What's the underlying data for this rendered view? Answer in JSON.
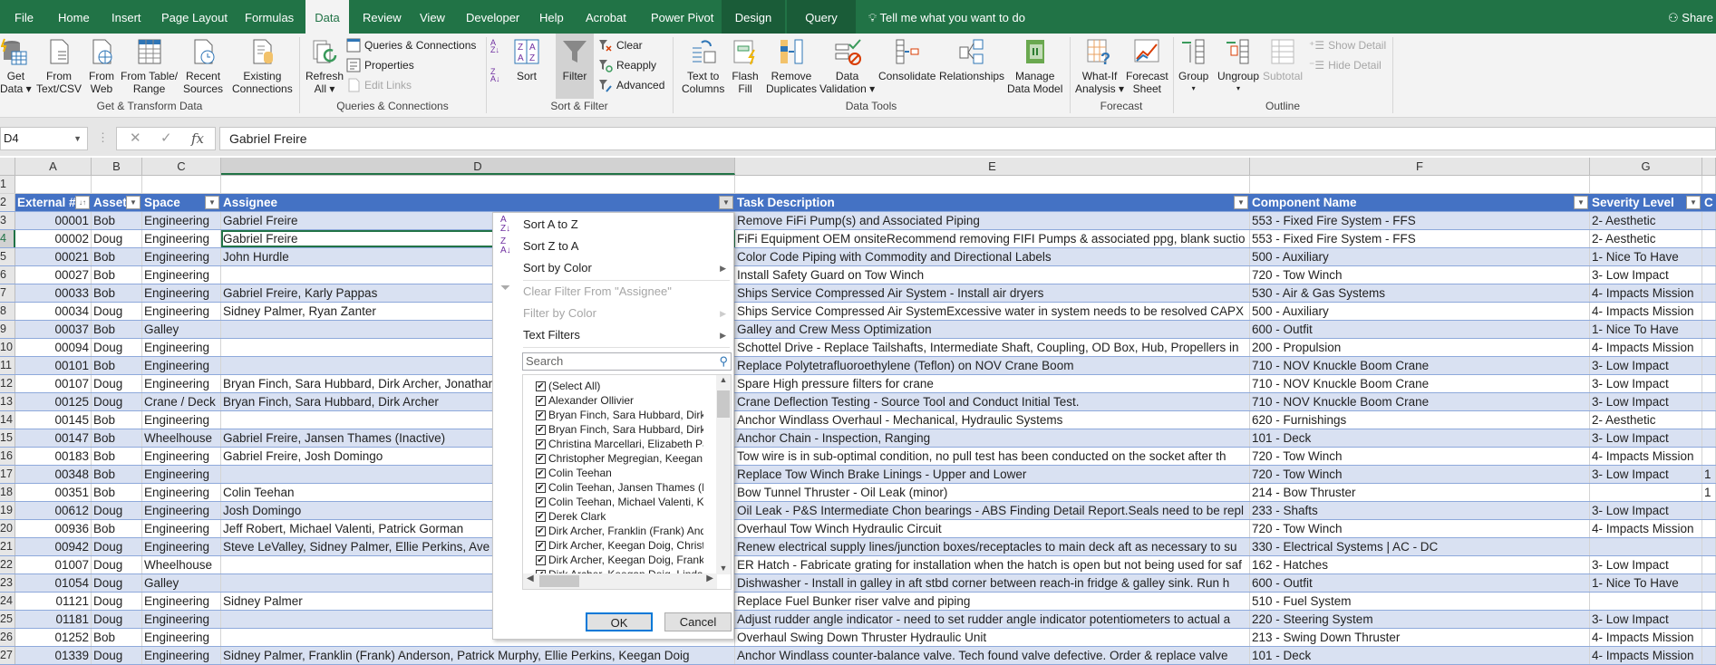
{
  "tabs": [
    "File",
    "Home",
    "Insert",
    "Page Layout",
    "Formulas",
    "Data",
    "Review",
    "View",
    "Developer",
    "Help",
    "Acrobat",
    "Power Pivot",
    "Design",
    "Query"
  ],
  "active_tab": "Data",
  "tell_me": "Tell me what you want to do",
  "share": "Share",
  "ribbon": {
    "get_data": [
      "Get",
      "Data ▾"
    ],
    "from_text": [
      "From",
      "Text/CSV"
    ],
    "from_web": [
      "From",
      "Web"
    ],
    "from_table": [
      "From Table/",
      "Range"
    ],
    "recent_sources": [
      "Recent",
      "Sources"
    ],
    "existing_connections": [
      "Existing",
      "Connections"
    ],
    "group_get_transform": "Get & Transform Data",
    "refresh_all": [
      "Refresh",
      "All ▾"
    ],
    "queries_connections": "Queries & Connections",
    "properties": "Properties",
    "edit_links": "Edit Links",
    "group_queries": "Queries & Connections",
    "sort": "Sort",
    "filter": "Filter",
    "clear": "Clear",
    "reapply": "Reapply",
    "advanced": "Advanced",
    "group_sort_filter": "Sort & Filter",
    "text_to_columns": [
      "Text to",
      "Columns"
    ],
    "flash_fill": [
      "Flash",
      "Fill"
    ],
    "remove_duplicates": [
      "Remove",
      "Duplicates"
    ],
    "data_validation": [
      "Data",
      "Validation ▾"
    ],
    "consolidate": "Consolidate",
    "relationships": "Relationships",
    "manage_data_model": [
      "Manage",
      "Data Model"
    ],
    "group_data_tools": "Data Tools",
    "what_if": [
      "What-If",
      "Analysis ▾"
    ],
    "forecast_sheet": [
      "Forecast",
      "Sheet"
    ],
    "group_forecast": "Forecast",
    "group": [
      "Group",
      "▾"
    ],
    "ungroup": [
      "Ungroup",
      "▾"
    ],
    "subtotal": "Subtotal",
    "show_detail": "Show Detail",
    "hide_detail": "Hide Detail",
    "group_outline": "Outline"
  },
  "formula_bar": {
    "name_box": "D4",
    "formula": "Gabriel Freire"
  },
  "columns": [
    "A",
    "B",
    "C",
    "D",
    "E",
    "F",
    "G",
    ""
  ],
  "headers": [
    "External #",
    "Asset",
    "Space",
    "Assignee",
    "Task Description",
    "Component Name",
    "Severity Level",
    "C"
  ],
  "rows": [
    [
      "00001",
      "Bob",
      "Engineering",
      "Gabriel Freire",
      "Remove FiFi Pump(s) and Associated Piping",
      "553 - Fixed Fire System - FFS",
      "2- Aesthetic",
      ""
    ],
    [
      "00002",
      "Doug",
      "Engineering",
      "Gabriel Freire",
      "FiFi Equipment OEM onsiteRecommend removing FIFI Pumps & associated ppg, blank suctio",
      "553 - Fixed Fire System - FFS",
      "2- Aesthetic",
      ""
    ],
    [
      "00021",
      "Bob",
      "Engineering",
      "John Hurdle",
      "Color Code Piping with Commodity and Directional Labels",
      "500 - Auxiliary",
      "1- Nice To Have",
      ""
    ],
    [
      "00027",
      "Bob",
      "Engineering",
      "",
      "Install Safety Guard on Tow Winch",
      "720 - Tow Winch",
      "3- Low Impact",
      ""
    ],
    [
      "00033",
      "Bob",
      "Engineering",
      "Gabriel Freire, Karly Pappas",
      "Ships Service Compressed Air System - Install air dryers",
      "530 - Air & Gas Systems",
      "4- Impacts Mission",
      ""
    ],
    [
      "00034",
      "Doug",
      "Engineering",
      "Sidney Palmer, Ryan Zanter",
      "Ships Service Compressed Air SystemExcessive water in system needs to be resolved CAPX",
      "500 - Auxiliary",
      "4- Impacts Mission",
      ""
    ],
    [
      "00037",
      "Bob",
      "Galley",
      "",
      "Galley and Crew Mess Optimization",
      "600 - Outfit",
      "1- Nice To Have",
      ""
    ],
    [
      "00094",
      "Doug",
      "Engineering",
      "",
      "Schottel Drive - Replace Tailshafts, Intermediate Shaft, Coupling, OD Box, Hub, Propellers in",
      "200 - Propulsion",
      "4- Impacts Mission",
      ""
    ],
    [
      "00101",
      "Bob",
      "Engineering",
      "",
      "Replace Polytetrafluoroethylene (Teflon) on NOV Crane Boom",
      "710 - NOV Knuckle Boom Crane",
      "3- Low Impact",
      ""
    ],
    [
      "00107",
      "Doug",
      "Engineering",
      "Bryan Finch, Sara Hubbard, Dirk Archer, Jonathan",
      "Spare High pressure filters for crane",
      "710 - NOV Knuckle Boom Crane",
      "3- Low Impact",
      ""
    ],
    [
      "00125",
      "Doug",
      "Crane / Deck",
      "Bryan Finch, Sara Hubbard, Dirk Archer",
      "Crane Deflection Testing - Source Tool and Conduct Initial Test.",
      "710 - NOV Knuckle Boom Crane",
      "3- Low Impact",
      ""
    ],
    [
      "00145",
      "Bob",
      "Engineering",
      "",
      "Anchor Windlass Overhaul - Mechanical, Hydraulic Systems",
      "620 - Furnishings",
      "2- Aesthetic",
      ""
    ],
    [
      "00147",
      "Bob",
      "Wheelhouse",
      "Gabriel Freire, Jansen Thames (Inactive)",
      "Anchor Chain - Inspection, Ranging",
      "101 - Deck",
      "3- Low Impact",
      ""
    ],
    [
      "00183",
      "Bob",
      "Engineering",
      "Gabriel Freire, Josh Domingo",
      "Tow wire is in sub-optimal condition, no pull test has been conducted on the socket after th",
      "720 - Tow Winch",
      "4- Impacts Mission",
      ""
    ],
    [
      "00348",
      "Bob",
      "Engineering",
      "",
      "Replace Tow Winch Brake Linings - Upper and Lower",
      "720 - Tow Winch",
      "3- Low Impact",
      "1"
    ],
    [
      "00351",
      "Bob",
      "Engineering",
      "Colin Teehan",
      "Bow Tunnel Thruster - Oil Leak (minor)",
      "214 - Bow Thruster",
      "",
      "1"
    ],
    [
      "00612",
      "Doug",
      "Engineering",
      "Josh Domingo",
      "Oil Leak - P&S Intermediate Chon bearings - ABS Finding Detail Report.Seals need to be repl",
      "233 - Shafts",
      "3- Low Impact",
      ""
    ],
    [
      "00936",
      "Bob",
      "Engineering",
      "Jeff Robert, Michael Valenti, Patrick Gorman",
      "Overhaul Tow Winch Hydraulic Circuit",
      "720 - Tow Winch",
      "4- Impacts Mission",
      ""
    ],
    [
      "00942",
      "Doug",
      "Engineering",
      "Steve LeValley, Sidney Palmer, Ellie Perkins, Ave",
      "Renew electrical supply lines/junction boxes/receptacles to main deck aft as necessary to su",
      "330 - Electrical Systems | AC - DC",
      "",
      ""
    ],
    [
      "01007",
      "Doug",
      "Wheelhouse",
      "",
      "ER Hatch - Fabricate grating for installation when the hatch is open but not being used for saf",
      "162 - Hatches",
      "3- Low Impact",
      ""
    ],
    [
      "01054",
      "Doug",
      "Galley",
      "",
      "Dishwasher - Install in galley in aft stbd corner between reach-in fridge & galley sink.  Run h",
      "600 - Outfit",
      "1- Nice To Have",
      ""
    ],
    [
      "01121",
      "Doug",
      "Engineering",
      "Sidney Palmer",
      "Replace Fuel Bunker riser valve and piping",
      "510 - Fuel System",
      "",
      ""
    ],
    [
      "01181",
      "Doug",
      "Engineering",
      "",
      "Adjust rudder angle indicator - need to set rudder angle indicator potentiometers to actual a",
      "220 - Steering System",
      "3- Low Impact",
      ""
    ],
    [
      "01252",
      "Bob",
      "Engineering",
      "",
      "Overhaul Swing Down Thruster Hydraulic Unit",
      "213 - Swing Down Thruster",
      "4- Impacts Mission",
      ""
    ],
    [
      "01339",
      "Doug",
      "Engineering",
      "Sidney Palmer, Franklin (Frank) Anderson, Patrick Murphy, Ellie Perkins, Keegan Doig",
      "Anchor Windlass counter-balance valve.  Tech found valve defective.  Order & replace valve",
      "101 - Deck",
      "4- Impacts Mission",
      ""
    ]
  ],
  "filter_menu": {
    "sort_az": "Sort A to Z",
    "sort_za": "Sort Z to A",
    "sort_by_color": "Sort by Color",
    "clear_filter": "Clear Filter From \"Assignee\"",
    "filter_by_color": "Filter by Color",
    "text_filters": "Text Filters",
    "search_placeholder": "Search",
    "items": [
      "(Select All)",
      "Alexander Ollivier",
      "Bryan Finch, Sara Hubbard, Dirk A",
      "Bryan Finch, Sara Hubbard, Dirk A",
      "Christina Marcellari, Elizabeth Payı",
      "Christopher Megregian, Keegan D",
      "Colin Teehan",
      "Colin Teehan, Jansen Thames (Ina",
      "Colin Teehan, Michael Valenti, Kee",
      "Derek Clark",
      "Dirk Archer, Franklin (Frank) Ande",
      "Dirk Archer, Keegan Doig, Christo",
      "Dirk Archer, Keegan Doig, Franklin",
      "Dirk Archer, Keegan Doig, Lindsay"
    ],
    "ok": "OK",
    "cancel": "Cancel"
  },
  "colors": {
    "ribbon_green": "#217346",
    "table_header": "#4472c4",
    "band": "#d9e1f2"
  }
}
